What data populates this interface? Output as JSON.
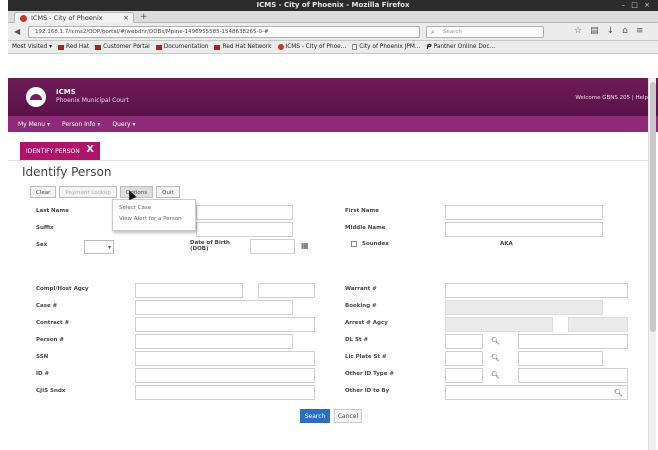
{
  "browser": {
    "window_title": "ICMS - City of Phoenix - Mozilla Firefox",
    "window_controls": "– □ ×",
    "tab_title": "ICMS - City of Phoenix",
    "tab_close": "×",
    "new_tab": "+",
    "url": "192.168.1.7/icms2/OOP/portal/#/webdnr/DDBs/Mpine-1496955585-1548638265-0-#",
    "search_placeholder": "Search",
    "bookmarks": [
      {
        "label": "Most Visited ▾",
        "icon": "none"
      },
      {
        "label": "Red Hat",
        "icon": "red"
      },
      {
        "label": "Customer Portal",
        "icon": "red"
      },
      {
        "label": "Documentation",
        "icon": "red"
      },
      {
        "label": "Red Hat Network",
        "icon": "red"
      },
      {
        "label": "ICMS - City of Phoe...",
        "icon": "globe"
      },
      {
        "label": "City of Phoenix JPM...",
        "icon": "page"
      },
      {
        "label": "Panther Online Doc...",
        "icon": "p"
      }
    ]
  },
  "app": {
    "name": "ICMS",
    "subtitle": "Phoenix Municipal Court",
    "welcome": "Welcome GBNS 205 | Help",
    "menu": [
      "My Menu ▾",
      "Person Info ▾",
      "Query ▾"
    ],
    "page_tab": "IDENTIFY PERSON",
    "page_tab_close": "X",
    "page_title": "Identify Person"
  },
  "toolbar": {
    "clear": "Clear",
    "payment_lookup": "Payment Lookup",
    "options": "Options",
    "quit": "Quit"
  },
  "options_menu": [
    "Select Case",
    "View Alert for a Person"
  ],
  "form": {
    "last_name": "Last Name",
    "first_name": "First Name",
    "suffix": "Suffix",
    "middle_name": "Middle Name",
    "sex": "Sex",
    "dob_line1": "Date of Birth",
    "dob_line2": "(DOB)",
    "sounds": "Soundex",
    "aka": "AKA",
    "compl_agency": "Compl/Host Agcy",
    "warrant": "Warrant #",
    "case": "Case #",
    "booking": "Booking #",
    "citation": "Contract #",
    "arrest": "Arrest # Agcy",
    "person": "Person #",
    "dl": "DL St #",
    "ssn": "SSN",
    "lic_plate": "Lic Plate St #",
    "id": "ID #",
    "other_id": "Other ID Type #",
    "cjis": "CJIS Sndx",
    "other_id_by": "Other ID to By"
  },
  "actions": {
    "search": "Search",
    "cancel": "Cancel"
  }
}
